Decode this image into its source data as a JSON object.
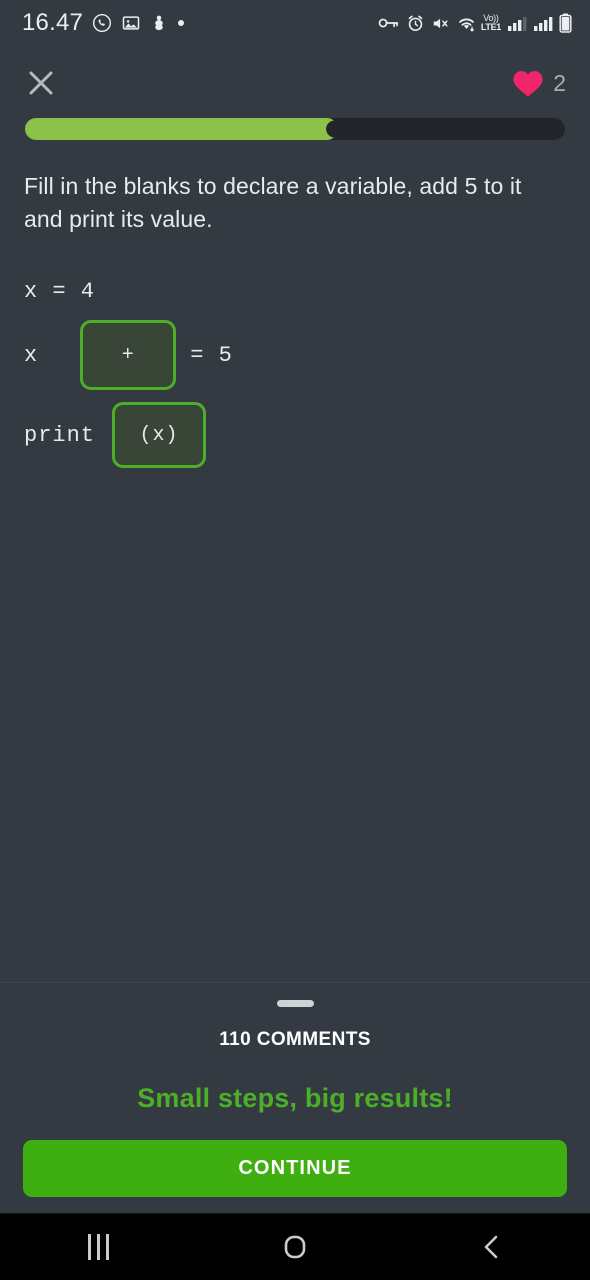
{
  "status_bar": {
    "time": "16.47",
    "left_icons": [
      "whatsapp-icon",
      "gallery-icon",
      "app-icon",
      "dot-icon"
    ],
    "volte_top": "Vo))",
    "volte_bottom": "LTE1",
    "right_icons": [
      "vpn-key-icon",
      "alarm-icon",
      "mute-vibrate-icon",
      "wifi-icon",
      "volte-badge",
      "signal-sim1-icon",
      "signal-sim2-icon",
      "battery-icon"
    ]
  },
  "header": {
    "close_label": "close-icon",
    "hearts_count": "2"
  },
  "progress": {
    "percent": 58,
    "fill_color": "#8bc34a",
    "track_color": "#22262b"
  },
  "lesson": {
    "prompt": "Fill in the blanks to declare a variable, add 5 to it and print its value.",
    "code_lines": [
      {
        "tokens": [
          "x = 4"
        ]
      },
      {
        "prefix": "x",
        "blank": "+",
        "suffix": "= 5"
      },
      {
        "prefix": "print",
        "blank": "(x)",
        "suffix": ""
      }
    ],
    "blank_one": "+",
    "blank_two": "(x)"
  },
  "bottom_sheet": {
    "comments_label": "110 COMMENTS",
    "encouragement": "Small steps, big results!",
    "continue_label": "CONTINUE",
    "continue_color": "#3fae10",
    "encourage_color": "#4caf27"
  },
  "nav_bar": {
    "recents": "recents-icon",
    "home": "home-icon",
    "back": "back-icon"
  }
}
